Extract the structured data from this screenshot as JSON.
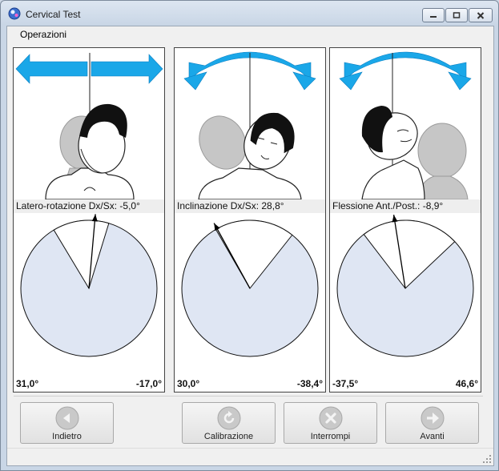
{
  "window": {
    "title": "Cervical Test",
    "app_icon": "cervical-app-icon",
    "controls": {
      "minimize": "minimize-icon",
      "maximize": "maximize-icon",
      "close": "close-icon"
    }
  },
  "menu": {
    "items": [
      "Operazioni"
    ]
  },
  "panels": [
    {
      "id": "rotazione",
      "measure_label": "Latero-rotazione Dx/Sx: -5,0°",
      "range_left": "31,0°",
      "range_right": "-17,0°",
      "current_value": -5.0,
      "min_value": -17.0,
      "max_value": 31.0,
      "illustration_icon": "head-rotation-icon",
      "arrow_icon": "horizontal-double-arrow-icon",
      "colors": {
        "arrow": "#1aa7e8",
        "gauge_fill": "#dfe6f3"
      }
    },
    {
      "id": "inclinazione",
      "measure_label": "Inclinazione Dx/Sx: 28,8°",
      "range_left": "30,0°",
      "range_right": "-38,4°",
      "current_value": 28.8,
      "min_value": -38.4,
      "max_value": 30.0,
      "illustration_icon": "head-tilt-icon",
      "arrow_icon": "curved-double-arrow-icon",
      "colors": {
        "arrow": "#1aa7e8",
        "gauge_fill": "#dfe6f3"
      }
    },
    {
      "id": "flessione",
      "measure_label": "Flessione Ant./Post.: -8,9°",
      "range_left": "-37,5°",
      "range_right": "46,6°",
      "current_value": -8.9,
      "min_value": -37.5,
      "max_value": 46.6,
      "illustration_icon": "head-flexion-icon",
      "arrow_icon": "curved-double-arrow-icon",
      "colors": {
        "arrow": "#1aa7e8",
        "gauge_fill": "#dfe6f3"
      }
    }
  ],
  "buttons": [
    {
      "id": "indietro",
      "label": "Indietro",
      "icon": "back-arrow-icon",
      "enabled": false
    },
    {
      "id": "calibrazione",
      "label": "Calibrazione",
      "icon": "refresh-icon",
      "enabled": false
    },
    {
      "id": "interrompi",
      "label": "Interrompi",
      "icon": "stop-x-icon",
      "enabled": false
    },
    {
      "id": "avanti",
      "label": "Avanti",
      "icon": "forward-arrow-icon",
      "enabled": false
    }
  ]
}
